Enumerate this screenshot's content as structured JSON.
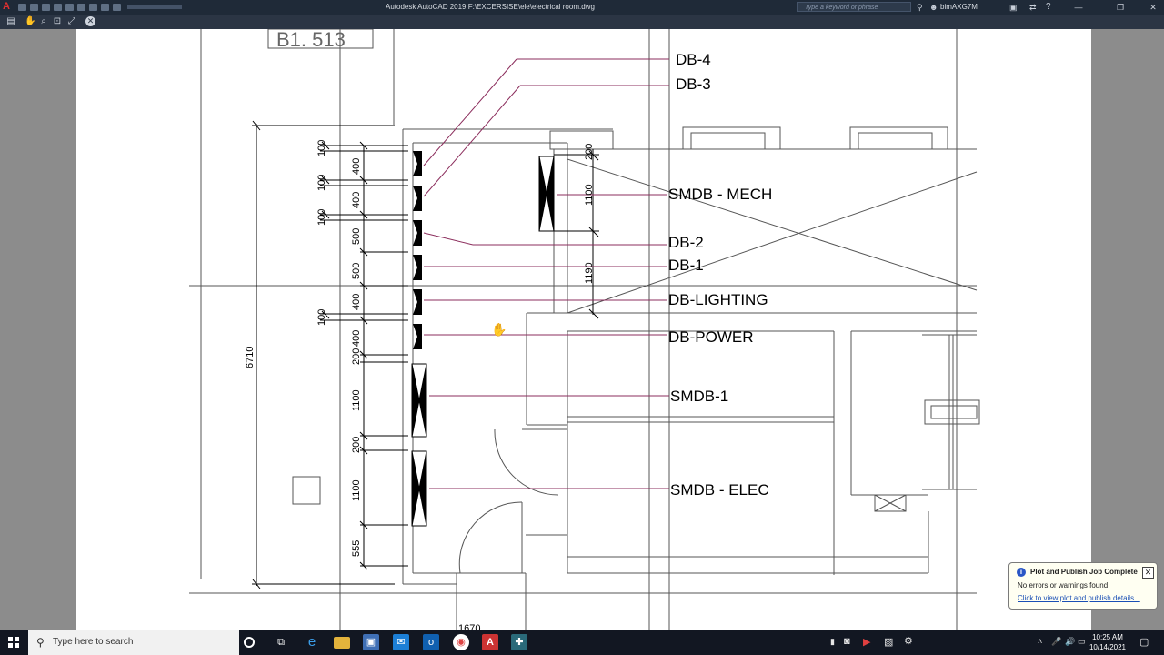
{
  "window": {
    "app_title": "Autodesk AutoCAD 2019    F:\\EXCERSISE\\ele\\electrical room.dwg",
    "search_placeholder": "Type a keyword or phrase",
    "user_name": "bimAXG7M",
    "minimize": "—",
    "restore": "❐",
    "close": "✕"
  },
  "drawing": {
    "room_tag": "B1. 513",
    "labels": {
      "db4": "DB-4",
      "db3": "DB-3",
      "smdb_mech": "SMDB - MECH",
      "db2": "DB-2",
      "db1": "DB-1",
      "db_lighting": "DB-LIGHTING",
      "db_power": "DB-POWER",
      "smdb1": "SMDB-1",
      "smdb_elec": "SMDB - ELEC"
    },
    "dims": {
      "total": "6710",
      "small": "100",
      "d400": "400",
      "d500": "500",
      "d200": "200",
      "d1100": "1100",
      "d555": "555",
      "d1190": "1190",
      "width": "1670"
    }
  },
  "notification": {
    "title": "Plot and Publish Job Complete",
    "message": "No errors or warnings found",
    "link": "Click to view plot and publish details...",
    "info_icon": "i",
    "close": "✕"
  },
  "taskbar": {
    "search_placeholder": "Type here to search",
    "time": "10:25 AM",
    "date": "10/14/2021"
  },
  "colors": {
    "leader": "#8b2d5c",
    "titlebar": "#1f2a38",
    "taskbar": "#121722"
  }
}
